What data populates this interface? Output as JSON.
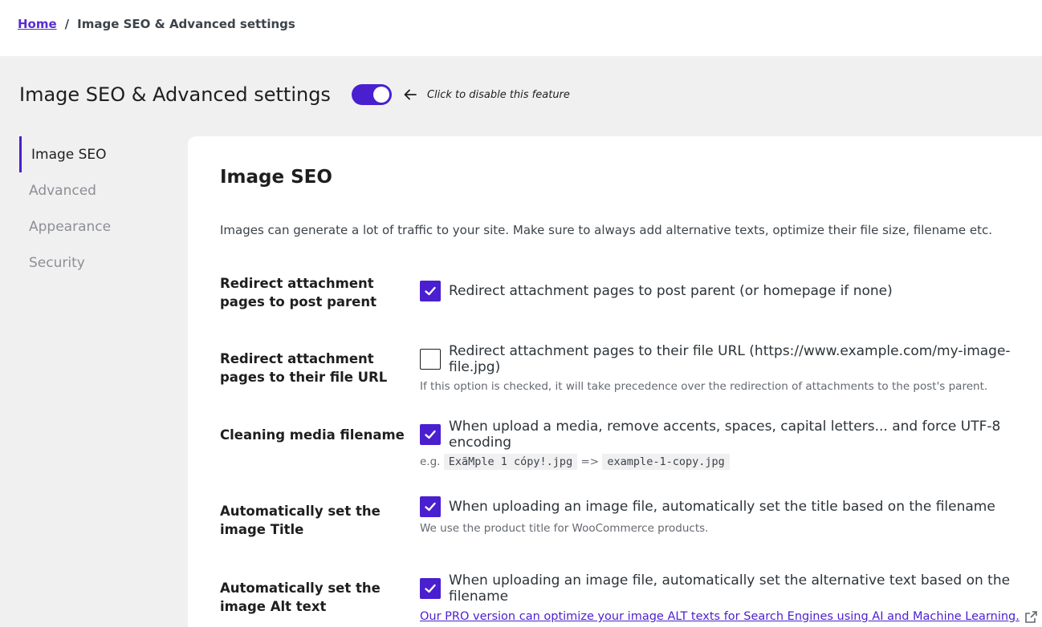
{
  "breadcrumb": {
    "home": "Home",
    "separator": "/",
    "current": "Image SEO & Advanced settings"
  },
  "header": {
    "title": "Image SEO & Advanced settings",
    "toggle_on": true,
    "hint": "Click to disable this feature"
  },
  "sidebar": {
    "items": [
      {
        "label": "Image SEO",
        "active": true
      },
      {
        "label": "Advanced",
        "active": false
      },
      {
        "label": "Appearance",
        "active": false
      },
      {
        "label": "Security",
        "active": false
      }
    ]
  },
  "panel": {
    "title": "Image SEO",
    "intro": "Images can generate a lot of traffic to your site. Make sure to always add alternative texts, optimize their file size, filename etc.",
    "settings": [
      {
        "label": "Redirect attachment pages to post parent",
        "checked": true,
        "option": "Redirect attachment pages to post parent (or homepage if none)"
      },
      {
        "label": "Redirect attachment pages to their file URL",
        "checked": false,
        "option": "Redirect attachment pages to their file URL (https://www.example.com/my-image-file.jpg)",
        "description": "If this option is checked, it will take precedence over the redirection of attachments to the post's parent."
      },
      {
        "label": "Cleaning media filename",
        "checked": true,
        "option": "When upload a media, remove accents, spaces, capital letters... and force UTF-8 encoding",
        "example_prefix": "e.g.",
        "example_before": "ExãMple 1 cópy!.jpg",
        "example_arrow": "=>",
        "example_after": "example-1-copy.jpg"
      },
      {
        "label": "Automatically set the image Title",
        "checked": true,
        "option": "When uploading an image file, automatically set the title based on the filename",
        "description": "We use the product title for WooCommerce products."
      },
      {
        "label": "Automatically set the image Alt text",
        "checked": true,
        "option": "When uploading an image file, automatically set the alternative text based on the filename",
        "link": "Our PRO version can optimize your image ALT texts for Search Engines using AI and Machine Learning."
      }
    ]
  },
  "colors": {
    "accent": "#4a1fcf",
    "background": "#f0f0f1",
    "panel": "#ffffff"
  },
  "icons": {
    "hint_arrow": "arrow-left-icon",
    "checkbox": "checkmark-icon",
    "external": "external-link-icon"
  }
}
